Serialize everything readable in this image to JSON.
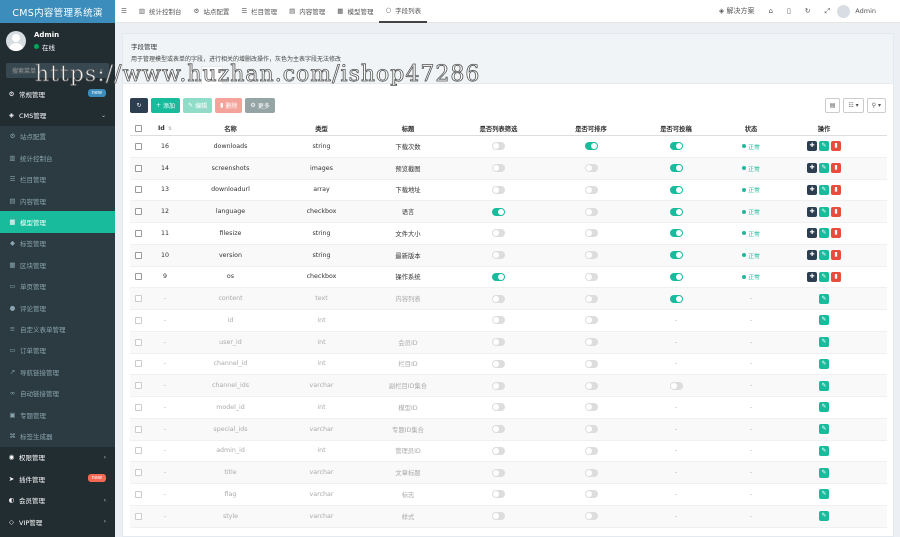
{
  "app": {
    "brand": "CMS内容管理系统演"
  },
  "user": {
    "name": "Admin",
    "status": "在线"
  },
  "search": {
    "placeholder": "搜索菜单"
  },
  "sidebar": {
    "items": [
      {
        "label": "常规管理",
        "icon": "gear-icon",
        "glyph": "⚙",
        "kind": "top",
        "badge": "new",
        "badge_color": "blue"
      },
      {
        "label": "CMS管理",
        "icon": "cube-icon",
        "glyph": "◈",
        "kind": "top",
        "caret": "⌄"
      },
      {
        "label": "站点配置",
        "icon": "cog-icon",
        "glyph": "⚙",
        "kind": "sub"
      },
      {
        "label": "统计控制台",
        "icon": "bar-chart-icon",
        "glyph": "▥",
        "kind": "sub"
      },
      {
        "label": "栏目管理",
        "icon": "list-icon",
        "glyph": "☰",
        "kind": "sub"
      },
      {
        "label": "内容管理",
        "icon": "file-icon",
        "glyph": "▤",
        "kind": "sub"
      },
      {
        "label": "模型管理",
        "icon": "table-icon",
        "glyph": "▦",
        "kind": "active"
      },
      {
        "label": "标签管理",
        "icon": "tag-icon",
        "glyph": "◆",
        "kind": "sub"
      },
      {
        "label": "区块管理",
        "icon": "grid-icon",
        "glyph": "▦",
        "kind": "sub"
      },
      {
        "label": "单页管理",
        "icon": "page-icon",
        "glyph": "▭",
        "kind": "sub"
      },
      {
        "label": "评论管理",
        "icon": "comment-icon",
        "glyph": "●",
        "kind": "sub"
      },
      {
        "label": "自定义表单管理",
        "icon": "form-icon",
        "glyph": "≡",
        "kind": "sub"
      },
      {
        "label": "订单管理",
        "icon": "cart-icon",
        "glyph": "▭",
        "kind": "sub"
      },
      {
        "label": "导航链接管理",
        "icon": "link-icon",
        "glyph": "↗",
        "kind": "sub"
      },
      {
        "label": "自动链接管理",
        "icon": "chain-icon",
        "glyph": "∞",
        "kind": "sub"
      },
      {
        "label": "专题管理",
        "icon": "folder-icon",
        "glyph": "▣",
        "kind": "sub"
      },
      {
        "label": "标签生成器",
        "icon": "code-icon",
        "glyph": "⌘",
        "kind": "sub"
      },
      {
        "label": "权限管理",
        "icon": "group-icon",
        "glyph": "◉",
        "kind": "top",
        "caret": "‹"
      },
      {
        "label": "插件管理",
        "icon": "rocket-icon",
        "glyph": "➤",
        "kind": "top",
        "badge": "new",
        "badge_color": "red"
      },
      {
        "label": "会员管理",
        "icon": "user-icon",
        "glyph": "◐",
        "kind": "top",
        "caret": "‹"
      },
      {
        "label": "VIP管理",
        "icon": "diamond-icon",
        "glyph": "◇",
        "kind": "top",
        "caret": "‹"
      }
    ]
  },
  "topnav": {
    "tabs": [
      {
        "label": "统计控制台",
        "icon": "bar-chart-icon",
        "glyph": "▥"
      },
      {
        "label": "站点配置",
        "icon": "cog-icon",
        "glyph": "⚙"
      },
      {
        "label": "栏目管理",
        "icon": "list-icon",
        "glyph": "☰"
      },
      {
        "label": "内容管理",
        "icon": "file-icon",
        "glyph": "▤"
      },
      {
        "label": "模型管理",
        "icon": "table-icon",
        "glyph": "▦"
      },
      {
        "label": "字段列表",
        "icon": "circle-icon",
        "glyph": "○",
        "active": true
      }
    ],
    "solution": "解决方案",
    "admin": "Admin"
  },
  "page": {
    "title": "字段管理",
    "desc": "用于管理模型或表单的字段，进行相关的增删改操作，灰色为主表字段无法修改"
  },
  "toolbar": {
    "add": "添加",
    "edit": "编辑",
    "delete": "删除",
    "more": "更多"
  },
  "table": {
    "headers": {
      "id": "Id",
      "name": "名称",
      "type": "类型",
      "title": "标题",
      "list": "是否列表筛选",
      "sort": "是否可排序",
      "post": "是否可投稿",
      "status": "状态",
      "ops": "操作"
    },
    "rows": [
      {
        "id": "16",
        "name": "downloads",
        "type": "string",
        "title": "下载次数",
        "list": 0,
        "sort": 1,
        "post": 1,
        "status": "正常",
        "editable": true
      },
      {
        "id": "14",
        "name": "screenshots",
        "type": "images",
        "title": "预览截图",
        "list": 0,
        "sort": 0,
        "post": 1,
        "status": "正常",
        "editable": true
      },
      {
        "id": "13",
        "name": "downloadurl",
        "type": "array",
        "title": "下载地址",
        "list": 0,
        "sort": 0,
        "post": 1,
        "status": "正常",
        "editable": true
      },
      {
        "id": "12",
        "name": "language",
        "type": "checkbox",
        "title": "语言",
        "list": 1,
        "sort": 0,
        "post": 1,
        "status": "正常",
        "editable": true
      },
      {
        "id": "11",
        "name": "filesize",
        "type": "string",
        "title": "文件大小",
        "list": 0,
        "sort": 0,
        "post": 1,
        "status": "正常",
        "editable": true
      },
      {
        "id": "10",
        "name": "version",
        "type": "string",
        "title": "最新版本",
        "list": 0,
        "sort": 0,
        "post": 1,
        "status": "正常",
        "editable": true
      },
      {
        "id": "9",
        "name": "os",
        "type": "checkbox",
        "title": "操作系统",
        "list": 1,
        "sort": 0,
        "post": 1,
        "status": "正常",
        "editable": true
      },
      {
        "id": "-",
        "name": "content",
        "type": "text",
        "title": "内容列表",
        "list": 0,
        "sort": 0,
        "post": 1,
        "status": "-",
        "editable": false
      },
      {
        "id": "-",
        "name": "id",
        "type": "int",
        "title": "",
        "list": 0,
        "sort": 0,
        "post": null,
        "status": "-",
        "editable": false
      },
      {
        "id": "-",
        "name": "user_id",
        "type": "int",
        "title": "会员ID",
        "list": 0,
        "sort": 0,
        "post": null,
        "status": "-",
        "editable": false
      },
      {
        "id": "-",
        "name": "channel_id",
        "type": "int",
        "title": "栏目ID",
        "list": 0,
        "sort": 0,
        "post": null,
        "status": "-",
        "editable": false
      },
      {
        "id": "-",
        "name": "channel_ids",
        "type": "varchar",
        "title": "副栏目ID集合",
        "list": 0,
        "sort": 0,
        "post": 0,
        "status": "-",
        "editable": false
      },
      {
        "id": "-",
        "name": "model_id",
        "type": "int",
        "title": "模型ID",
        "list": 0,
        "sort": 0,
        "post": null,
        "status": "-",
        "editable": false
      },
      {
        "id": "-",
        "name": "special_ids",
        "type": "varchar",
        "title": "专题ID集合",
        "list": 0,
        "sort": 0,
        "post": null,
        "status": "-",
        "editable": false
      },
      {
        "id": "-",
        "name": "admin_id",
        "type": "int",
        "title": "管理员ID",
        "list": 0,
        "sort": 0,
        "post": null,
        "status": "-",
        "editable": false
      },
      {
        "id": "-",
        "name": "title",
        "type": "varchar",
        "title": "文章标题",
        "list": 0,
        "sort": 0,
        "post": null,
        "status": "-",
        "editable": false
      },
      {
        "id": "-",
        "name": "flag",
        "type": "varchar",
        "title": "标志",
        "list": 0,
        "sort": 0,
        "post": null,
        "status": "-",
        "editable": false
      },
      {
        "id": "-",
        "name": "style",
        "type": "varchar",
        "title": "样式",
        "list": 0,
        "sort": 0,
        "post": null,
        "status": "-",
        "editable": false
      }
    ]
  },
  "watermark": "https://www.huzhan.com/ishop47286",
  "colors": {
    "accent": "#18bc9c",
    "sidebar": "#222d32",
    "brand": "#3c8dbc",
    "danger": "#e74c3c",
    "dark": "#2c3e50"
  }
}
